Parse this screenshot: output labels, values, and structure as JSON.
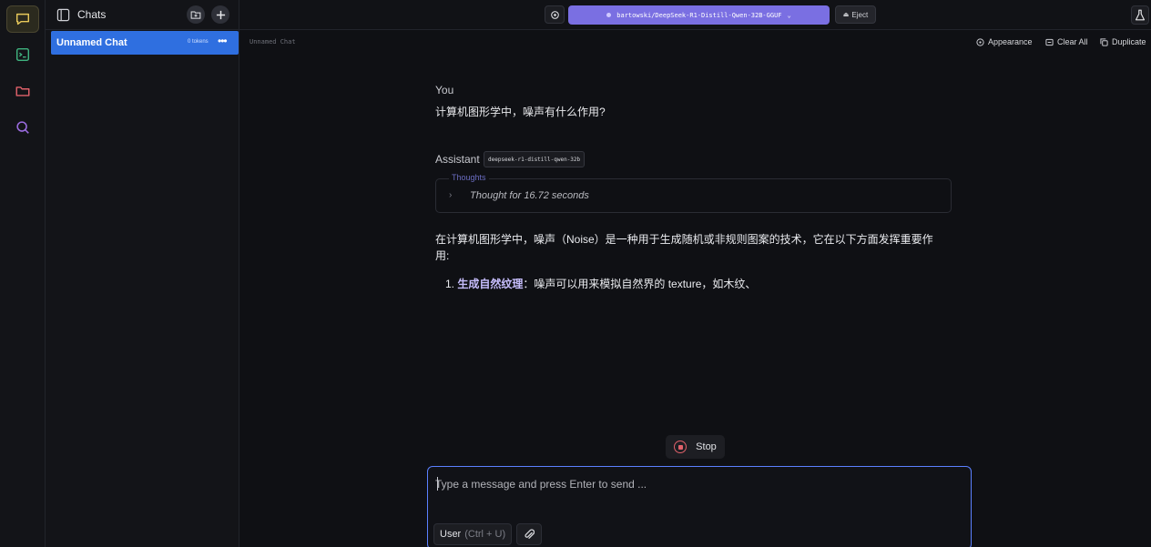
{
  "sidebar": {
    "title": "Chats",
    "chats": [
      {
        "name": "Unnamed Chat",
        "tokens": "0 tokens"
      }
    ]
  },
  "topbar": {
    "model": "bartowski/DeepSeek-R1-Distill-Qwen-32B-GGUF",
    "eject_label": "Eject"
  },
  "subbar": {
    "chat_title": "Unnamed Chat",
    "appearance": "Appearance",
    "clear_all": "Clear All",
    "duplicate": "Duplicate"
  },
  "messages": {
    "user_role": "You",
    "user_text": "计算机图形学中，噪声有什么作用?",
    "assistant_role": "Assistant",
    "assistant_model": "deepseek-r1-distill-qwen-32b",
    "thoughts_label": "Thoughts",
    "thoughts_summary": "Thought for 16.72 seconds",
    "answer_intro": "在计算机图形学中，噪声（Noise）是一种用于生成随机或非规则图案的技术，它在以下方面发挥重要作用:",
    "list": [
      {
        "number": "1.",
        "bold": "生成自然纹理",
        "rest": "：噪声可以用来模拟自然界的 texture，如木纹、"
      }
    ]
  },
  "composer": {
    "stop_label": "Stop",
    "placeholder": "Type a message and press Enter to send ...",
    "role_label": "User",
    "role_shortcut": "(Ctrl + U)"
  },
  "colors": {
    "accent": "#7a6fe2",
    "selected": "#2f6fe0",
    "stop": "#e0616a",
    "composer_border": "#5b80ff"
  }
}
